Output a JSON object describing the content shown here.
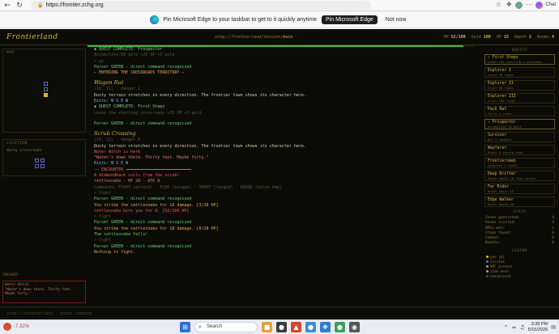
{
  "browser": {
    "url": "https://frontier.zchg.org",
    "chat_label": "Chat"
  },
  "pin_prompt": {
    "text": "Pin Microsoft Edge to your taskbar to get to it quickly anytime",
    "pin_button": "Pin Microsoft Edge",
    "dismiss_button": "Not now"
  },
  "game": {
    "title": "Frontierland",
    "path_prefix": "zchg://frontierland/session/",
    "path_current": "main",
    "stats": [
      {
        "label": "HP",
        "value": "52/100"
      },
      {
        "label": "Gold",
        "value": "100"
      },
      {
        "label": "XP",
        "value": "15"
      },
      {
        "label": "Depth",
        "value": "2"
      },
      {
        "label": "Rooms",
        "value": "4"
      }
    ],
    "progress": 0.97,
    "footer": "zchg://frontierland  ·  enter command"
  },
  "left_panel": {
    "map_title": "MAP",
    "location_title": "LOCATION",
    "location_text": "dusty crossroads",
    "speaker_title": "SPEAKER",
    "speaker_name": "Water Witch",
    "speaker_text": "\"Water's down there. Thirty feet. Maybe forty.\""
  },
  "log": [
    {
      "cls": "l-quest",
      "text": "◆ QUEST COMPLETE: Prospector"
    },
    {
      "cls": "l-dim",
      "text": "Accumulate 50 gold   +25 XP   +5 gold"
    },
    {
      "cls": "l-dim",
      "text": "> go"
    },
    {
      "cls": "l-green",
      "text": "Parser GREEN - direct command recognized"
    },
    {
      "cls": "l-orange",
      "text": "— ENTERING THE CROSSROADS TERRITORY —"
    },
    {
      "cls": "l-scene",
      "text": "Wagon Rut"
    },
    {
      "cls": "l-dim",
      "text": "(10, 11) · danger 1"
    },
    {
      "cls": "l-white",
      "text": "Dusty terrain stretches in every direction. The frontier town shows its character here."
    },
    {
      "cls": "l-cyan",
      "text": "Exits: N S E W"
    },
    {
      "cls": "l-quest",
      "text": "◆ QUEST COMPLETE: First Steps"
    },
    {
      "cls": "l-dim",
      "text": "Leave the starting crossroads   +25 XP   +5 gold"
    },
    {
      "cls": "gap",
      "text": ""
    },
    {
      "cls": "l-green",
      "text": "Parser GREEN - direct command recognized"
    },
    {
      "cls": "l-scene",
      "text": "Scrub Crossing"
    },
    {
      "cls": "l-dim",
      "text": "(10, 12) · danger 0"
    },
    {
      "cls": "l-white",
      "text": "Dusty terrain stretches in every direction. The frontier town shows its character here."
    },
    {
      "cls": "l-red",
      "text": "Water Witch is here"
    },
    {
      "cls": "l-pink",
      "text": "\"Water's down there. Thirty feet. Maybe forty.\""
    },
    {
      "cls": "l-cyan",
      "text": "Exits: N S E W"
    },
    {
      "cls": "l-enc",
      "text": "—— ENCOUNTER",
      "rule": true
    },
    {
      "cls": "l-red",
      "text": "A diamondback coils from the scrub!"
    },
    {
      "cls": "l-pink",
      "text": "rattlesnake - HP 28 - ATK 8"
    },
    {
      "cls": "l-dim",
      "text": "Commands: FIGHT (attack) · FLEE (escape) · SHOOT (ranged) · DODGE (halve dmg)"
    },
    {
      "cls": "l-dim",
      "text": "> fight"
    },
    {
      "cls": "l-green",
      "text": "Parser GREEN - direct command recognized"
    },
    {
      "cls": "l-orange",
      "text": "You strike the rattlesnake for 19 damage. [3/28 HP]"
    },
    {
      "cls": "l-red",
      "text": "rattlesnake bits you for 8. [52/100 HP]"
    },
    {
      "cls": "l-dim",
      "text": "> fight"
    },
    {
      "cls": "l-green",
      "text": "Parser GREEN - direct command recognized"
    },
    {
      "cls": "l-orange",
      "text": "You strike the rattlesnake for 18 damage. [0/28 HP]"
    },
    {
      "cls": "l-green",
      "text": "The rattlesnake falls!"
    },
    {
      "cls": "l-dim",
      "text": "> fight"
    },
    {
      "cls": "l-green",
      "text": "Parser GREEN - direct command recognized"
    },
    {
      "cls": "l-orange",
      "text": "Nothing to fight."
    }
  ],
  "right_panel": {
    "quests_title": "QUESTS",
    "quests": [
      {
        "name": "✓ First Steps",
        "desc": "Leave the starting crossroads",
        "done": true
      },
      {
        "name": "Explorer I",
        "desc": "Visit 10 rooms",
        "done": false
      },
      {
        "name": "Explorer II",
        "desc": "Visit 50 rooms",
        "done": false
      },
      {
        "name": "Explorer III",
        "desc": "Visit 100 rooms",
        "done": false
      },
      {
        "name": "Pack Rat",
        "desc": "Carry 5 items",
        "done": false
      },
      {
        "name": "✓ Prospector",
        "desc": "Accumulate 50 gold",
        "done": true
      },
      {
        "name": "Survivor",
        "desc": "Win 5 combats",
        "done": false
      },
      {
        "name": "Wayfarer",
        "desc": "Reach a second zone",
        "done": false
      },
      {
        "name": "Frontiersman",
        "desc": "Generate 5 zones",
        "done": false
      },
      {
        "name": "Deep Drifter",
        "desc": "Reach depth 10 from center",
        "done": false
      },
      {
        "name": "Far Rider",
        "desc": "Reach depth 25",
        "done": false
      },
      {
        "name": "Edge Walker",
        "desc": "Reach depth 50",
        "done": false
      }
    ],
    "stats_title": "STATS",
    "stats": [
      {
        "label": "Zones generated:",
        "value": "0"
      },
      {
        "label": "Rooms visited:",
        "value": "4"
      },
      {
        "label": "NPCs met:",
        "value": "1"
      },
      {
        "label": "Items found:",
        "value": "0"
      },
      {
        "label": "Combat:",
        "value": "0"
      },
      {
        "label": "Deaths:",
        "value": "0"
      }
    ],
    "legend_title": "LEGEND",
    "legend": [
      {
        "label": "you [@]",
        "color": "#e0b23c"
      },
      {
        "label": "visited",
        "color": "#5a6bc0"
      },
      {
        "label": "NPC present",
        "color": "#5fcf6a"
      },
      {
        "label": "item here",
        "color": "#e07a86"
      },
      {
        "label": "unexplored",
        "color": "#4e482c"
      }
    ]
  },
  "taskbar": {
    "weather": "-7.32%",
    "search_label": "Search",
    "time": "3:39 PM",
    "date": "5/15/2026"
  }
}
